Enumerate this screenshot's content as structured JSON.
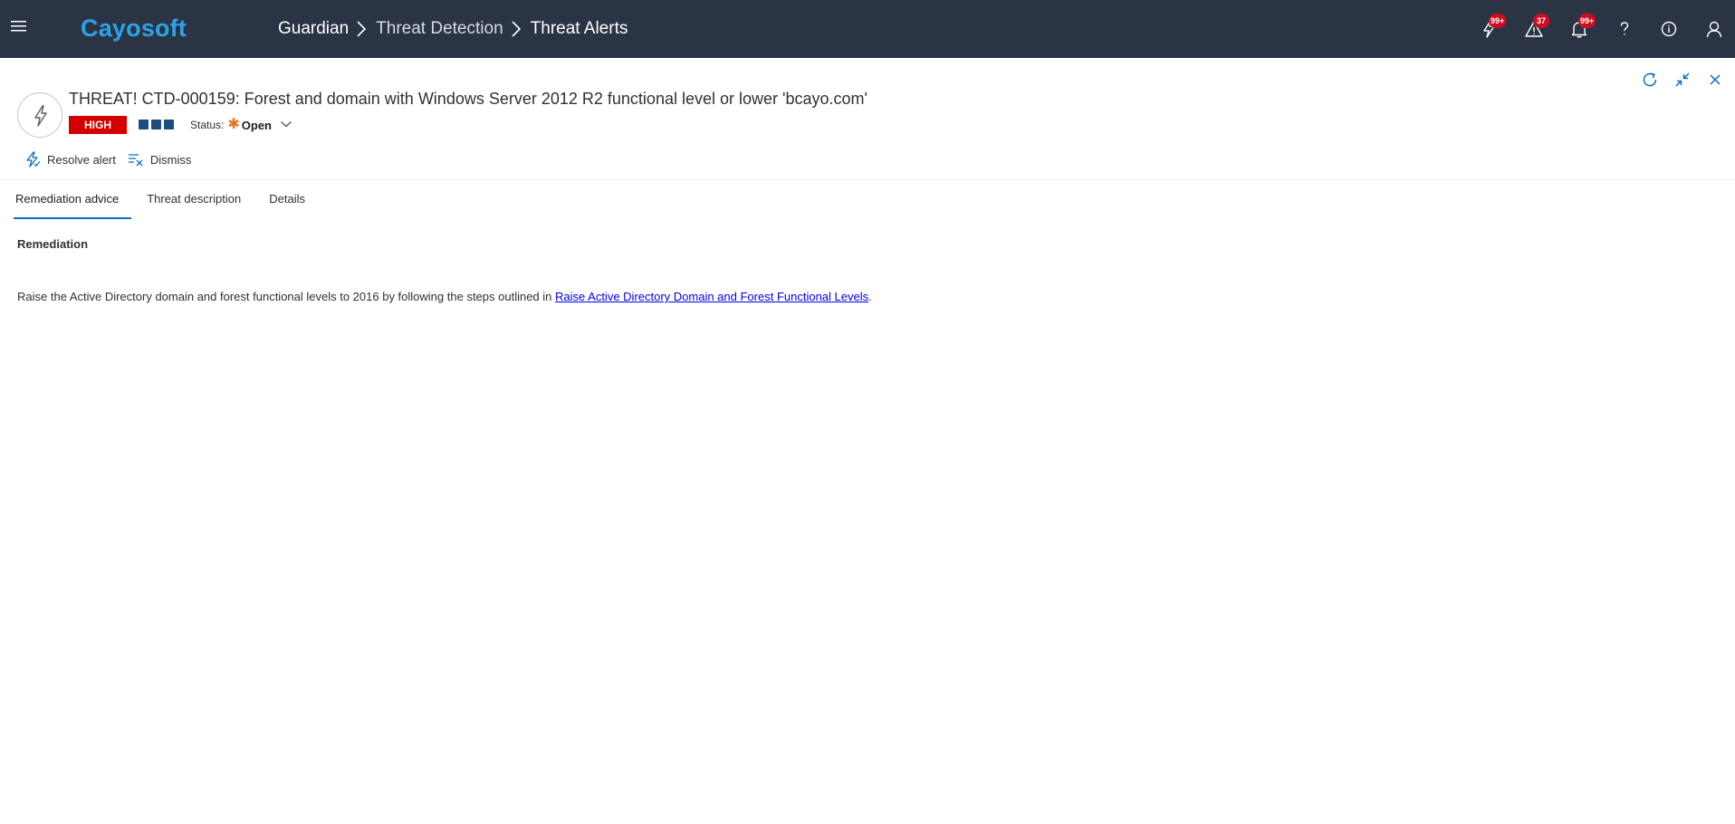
{
  "app": {
    "logo": "Cayosoft"
  },
  "breadcrumb": [
    "Guardian",
    "Threat Detection",
    "Threat Alerts"
  ],
  "topbar_icons": [
    {
      "icon": "threat-bolt-icon",
      "badge": "99+"
    },
    {
      "icon": "warning-triangle-icon",
      "badge": "37"
    },
    {
      "icon": "notification-bell-icon",
      "badge": "99+"
    },
    {
      "icon": "help-icon",
      "badge": ""
    },
    {
      "icon": "info-icon",
      "badge": ""
    },
    {
      "icon": "user-icon",
      "badge": ""
    }
  ],
  "alert": {
    "title": "THREAT! CTD-000159: Forest and domain with Windows Server 2012 R2 functional level or lower 'bcayo.com'",
    "severity": "HIGH",
    "severity_level_squares": 3,
    "status_label": "Status:",
    "status_value": "Open"
  },
  "commands": {
    "resolve": "Resolve alert",
    "dismiss": "Dismiss"
  },
  "tabs": [
    {
      "label": "Remediation advice",
      "active": true
    },
    {
      "label": "Threat description",
      "active": false
    },
    {
      "label": "Details",
      "active": false
    }
  ],
  "remediation": {
    "heading": "Remediation",
    "text_before": "Raise the Active Directory domain and forest functional levels to 2016 by following the steps outlined in ",
    "link_text": "Raise Active Directory Domain and Forest Functional Levels",
    "text_after": "."
  },
  "colors": {
    "topbar_bg": "#2b3444",
    "logo": "#2aa3e6",
    "severity_high": "#d40000",
    "badge": "#cc0d20",
    "accent": "#0f6cbd",
    "status_open": "#e8731b"
  }
}
